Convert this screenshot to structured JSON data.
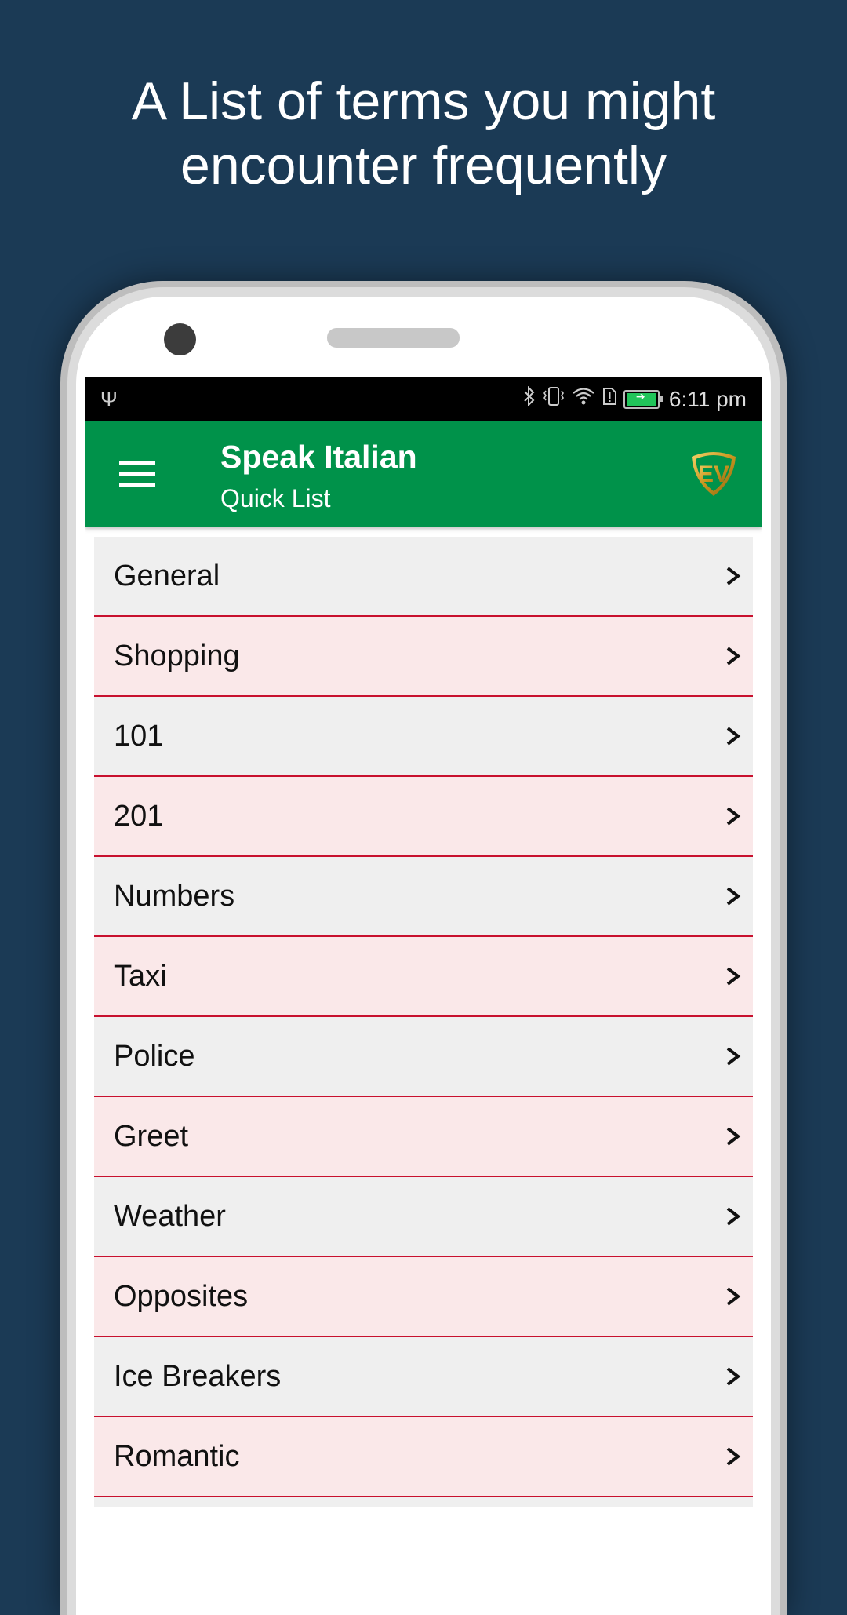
{
  "headline": {
    "line1": "A List of terms you might",
    "line2": "encounter frequently"
  },
  "statusbar": {
    "left_icons": [
      "usb-icon"
    ],
    "right_icons": [
      "bluetooth-icon",
      "vibrate-icon",
      "wifi-icon",
      "sim-alert-icon",
      "battery-charging-icon"
    ],
    "time": "6:11 pm",
    "battery_color": "#21c45a"
  },
  "appbar": {
    "title": "Speak Italian",
    "subtitle": "Quick List",
    "background": "#00924a",
    "menu_icon": "hamburger-icon",
    "logo": "EV"
  },
  "list": {
    "divider_color": "#c8102e",
    "items": [
      {
        "label": "General"
      },
      {
        "label": "Shopping"
      },
      {
        "label": "101"
      },
      {
        "label": "201"
      },
      {
        "label": "Numbers"
      },
      {
        "label": "Taxi"
      },
      {
        "label": "Police"
      },
      {
        "label": "Greet"
      },
      {
        "label": "Weather"
      },
      {
        "label": "Opposites"
      },
      {
        "label": "Ice Breakers"
      },
      {
        "label": "Romantic"
      },
      {
        "label": ""
      }
    ],
    "chevron": ">"
  }
}
